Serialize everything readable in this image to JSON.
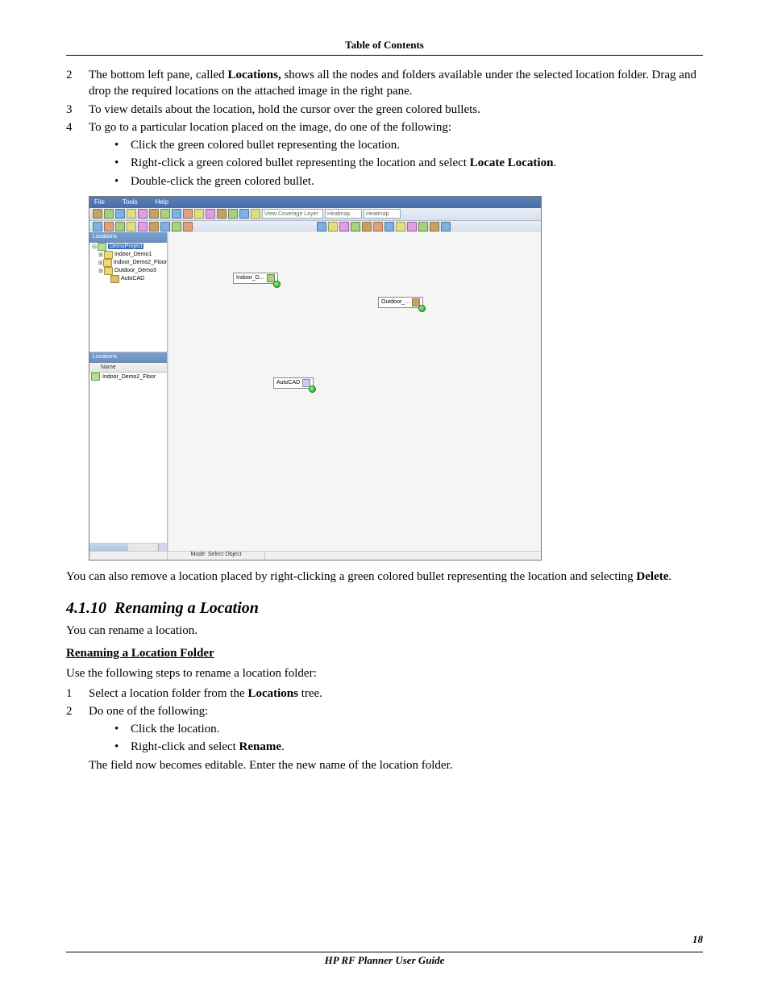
{
  "header": {
    "toc": "Table of Contents"
  },
  "list": {
    "i2": {
      "num": "2",
      "text_a": "The bottom left pane, called ",
      "bold": "Locations,",
      "text_b": " shows all the nodes and folders available under the selected location folder. Drag and drop the required locations on the attached image in the right pane."
    },
    "i3": {
      "num": "3",
      "text": "To view details about the location, hold the cursor over the green colored bullets."
    },
    "i4": {
      "num": "4",
      "text": "To go to a particular location placed on the image, do one of the following:",
      "b1": "Click the green colored bullet representing the location.",
      "b2_a": "Right-click a green colored bullet representing the location and select ",
      "b2_bold": "Locate Location",
      "b2_b": ".",
      "b3": "Double-click the green colored bullet."
    }
  },
  "screenshot": {
    "menu": {
      "file": "File",
      "tools": "Tools",
      "help": "Help"
    },
    "toolbar_field1": "View Coverage Layer",
    "toolbar_field2": "Heatmap",
    "toolbar_field3": "Heatmap",
    "tree": {
      "header": "Locations",
      "root": "DemoProject",
      "n1": "Indoor_Demo1",
      "n2": "Indoor_Demo2_Floor",
      "n3": "Outdoor_Demo3",
      "n4": "AutoCAD"
    },
    "locpane": {
      "header": "Locations",
      "col": "Name",
      "row1": "Indoor_Demo2_Floor"
    },
    "pins": {
      "p1": "Indoor_D...",
      "p2": "Outdoor_...",
      "p3": "AutoCAD"
    },
    "status": "Mode: Select Object"
  },
  "after_img": {
    "text_a": "You can also remove a location placed by right-clicking a green colored bullet representing the location and selecting ",
    "bold": "Delete",
    "text_b": "."
  },
  "section": {
    "num": "4.1.10",
    "title": "Renaming a Location"
  },
  "section_intro": "You can rename a location.",
  "subhead": "Renaming a Location Folder",
  "steps": {
    "intro": "Use the following steps to rename a location folder:",
    "s1": {
      "num": "1",
      "text_a": "Select a location folder from the ",
      "bold": "Locations",
      "text_b": " tree."
    },
    "s2": {
      "num": "2",
      "text": "Do one of the following:",
      "b1": "Click the location.",
      "b2_a": "Right-click and select ",
      "b2_bold": "Rename",
      "b2_b": ".",
      "after": "The field now becomes editable. Enter the new name of the location folder."
    }
  },
  "footer": {
    "title": "HP RF Planner User Guide",
    "page": "18"
  }
}
